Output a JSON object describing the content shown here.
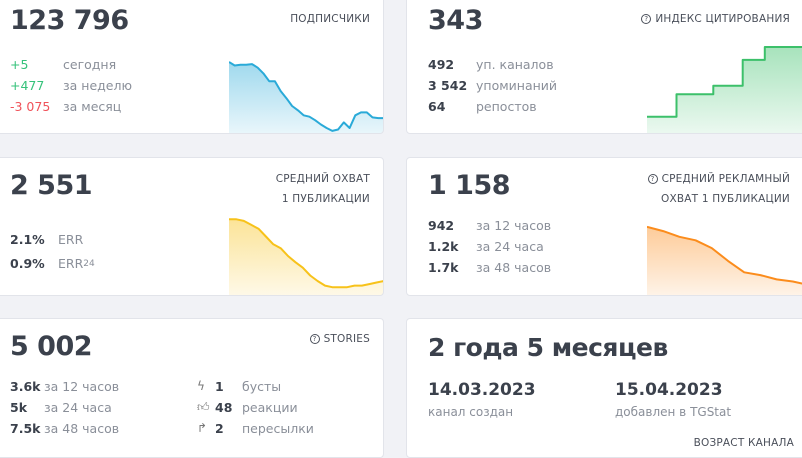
{
  "subscribers": {
    "value": "123 796",
    "title": "ПОДПИСЧИКИ",
    "rows": [
      {
        "v": "+5",
        "l": "сегодня",
        "tone": "g"
      },
      {
        "v": "+477",
        "l": "за неделю",
        "tone": "g"
      },
      {
        "v": "-3 075",
        "l": "за месяц",
        "tone": "r"
      }
    ],
    "color": "#2aaad8",
    "series": [
      100,
      95,
      96,
      96,
      97,
      92,
      84,
      73,
      73,
      59,
      49,
      38,
      32,
      25,
      23,
      18,
      12,
      7,
      3,
      5,
      15,
      7,
      25,
      29,
      29,
      22,
      21,
      21
    ]
  },
  "citation": {
    "value": "343",
    "title": "ИНДЕКС ЦИТИРОВАНИЯ",
    "icon": "question-circle-icon",
    "rows": [
      {
        "v": "492",
        "l": "уп. каналов"
      },
      {
        "v": "3 542",
        "l": "упоминаний"
      },
      {
        "v": "64",
        "l": "репостов"
      }
    ],
    "color": "#3cc06a",
    "series": [
      19,
      19,
      19,
      19,
      45,
      45,
      45,
      45,
      45,
      55,
      55,
      55,
      55,
      85,
      85,
      85,
      100,
      100,
      100,
      100,
      100,
      100,
      100
    ]
  },
  "reach": {
    "value": "2 551",
    "title1": "СРЕДНИЙ ОХВАТ",
    "title2": "1 ПУБЛИКАЦИИ",
    "rows": [
      {
        "v": "2.1%",
        "l": "ERR"
      },
      {
        "v": "0.9%",
        "l": "ERR",
        "sub": "24"
      }
    ],
    "color": "#f7c21a",
    "series": [
      97,
      97,
      95,
      90,
      85,
      75,
      65,
      60,
      50,
      42,
      35,
      25,
      18,
      12,
      10,
      10,
      10,
      12,
      12,
      14,
      16,
      18
    ]
  },
  "ad_reach": {
    "value": "1 158",
    "title1": "СРЕДНИЙ РЕКЛАМНЫЙ",
    "title2": "ОХВАТ 1 ПУБЛИКАЦИИ",
    "icon": "question-circle-icon",
    "rows": [
      {
        "v": "942",
        "l": "за 12 часов"
      },
      {
        "v": "1.2k",
        "l": "за 24 часа"
      },
      {
        "v": "1.7k",
        "l": "за 48 часов"
      }
    ],
    "color": "#fb8c1c",
    "series": [
      96,
      90,
      82,
      77,
      66,
      48,
      32,
      28,
      22,
      19,
      14
    ]
  },
  "stories": {
    "value": "5 002",
    "title": "STORIES",
    "icon": "question-circle-icon",
    "rows": [
      {
        "v": "3.6k",
        "l": "за 12 часов"
      },
      {
        "v": "5k",
        "l": "за 24 часа"
      },
      {
        "v": "7.5k",
        "l": "за 48 часов"
      }
    ],
    "stats": [
      {
        "icon": "boost-icon",
        "glyph": "ϟ",
        "v": "1",
        "l": "бусты"
      },
      {
        "icon": "thumbs-up-icon",
        "glyph": "👍︎",
        "v": "48",
        "l": "реакции"
      },
      {
        "icon": "forward-icon",
        "glyph": "↱",
        "v": "2",
        "l": "пересылки"
      }
    ]
  },
  "age": {
    "value": "2 года 5 месяцев",
    "created": "14.03.2023",
    "created_label": "канал создан",
    "added": "15.04.2023",
    "added_label": "добавлен в TGStat",
    "title": "ВОЗРАСТ КАНАЛА"
  }
}
